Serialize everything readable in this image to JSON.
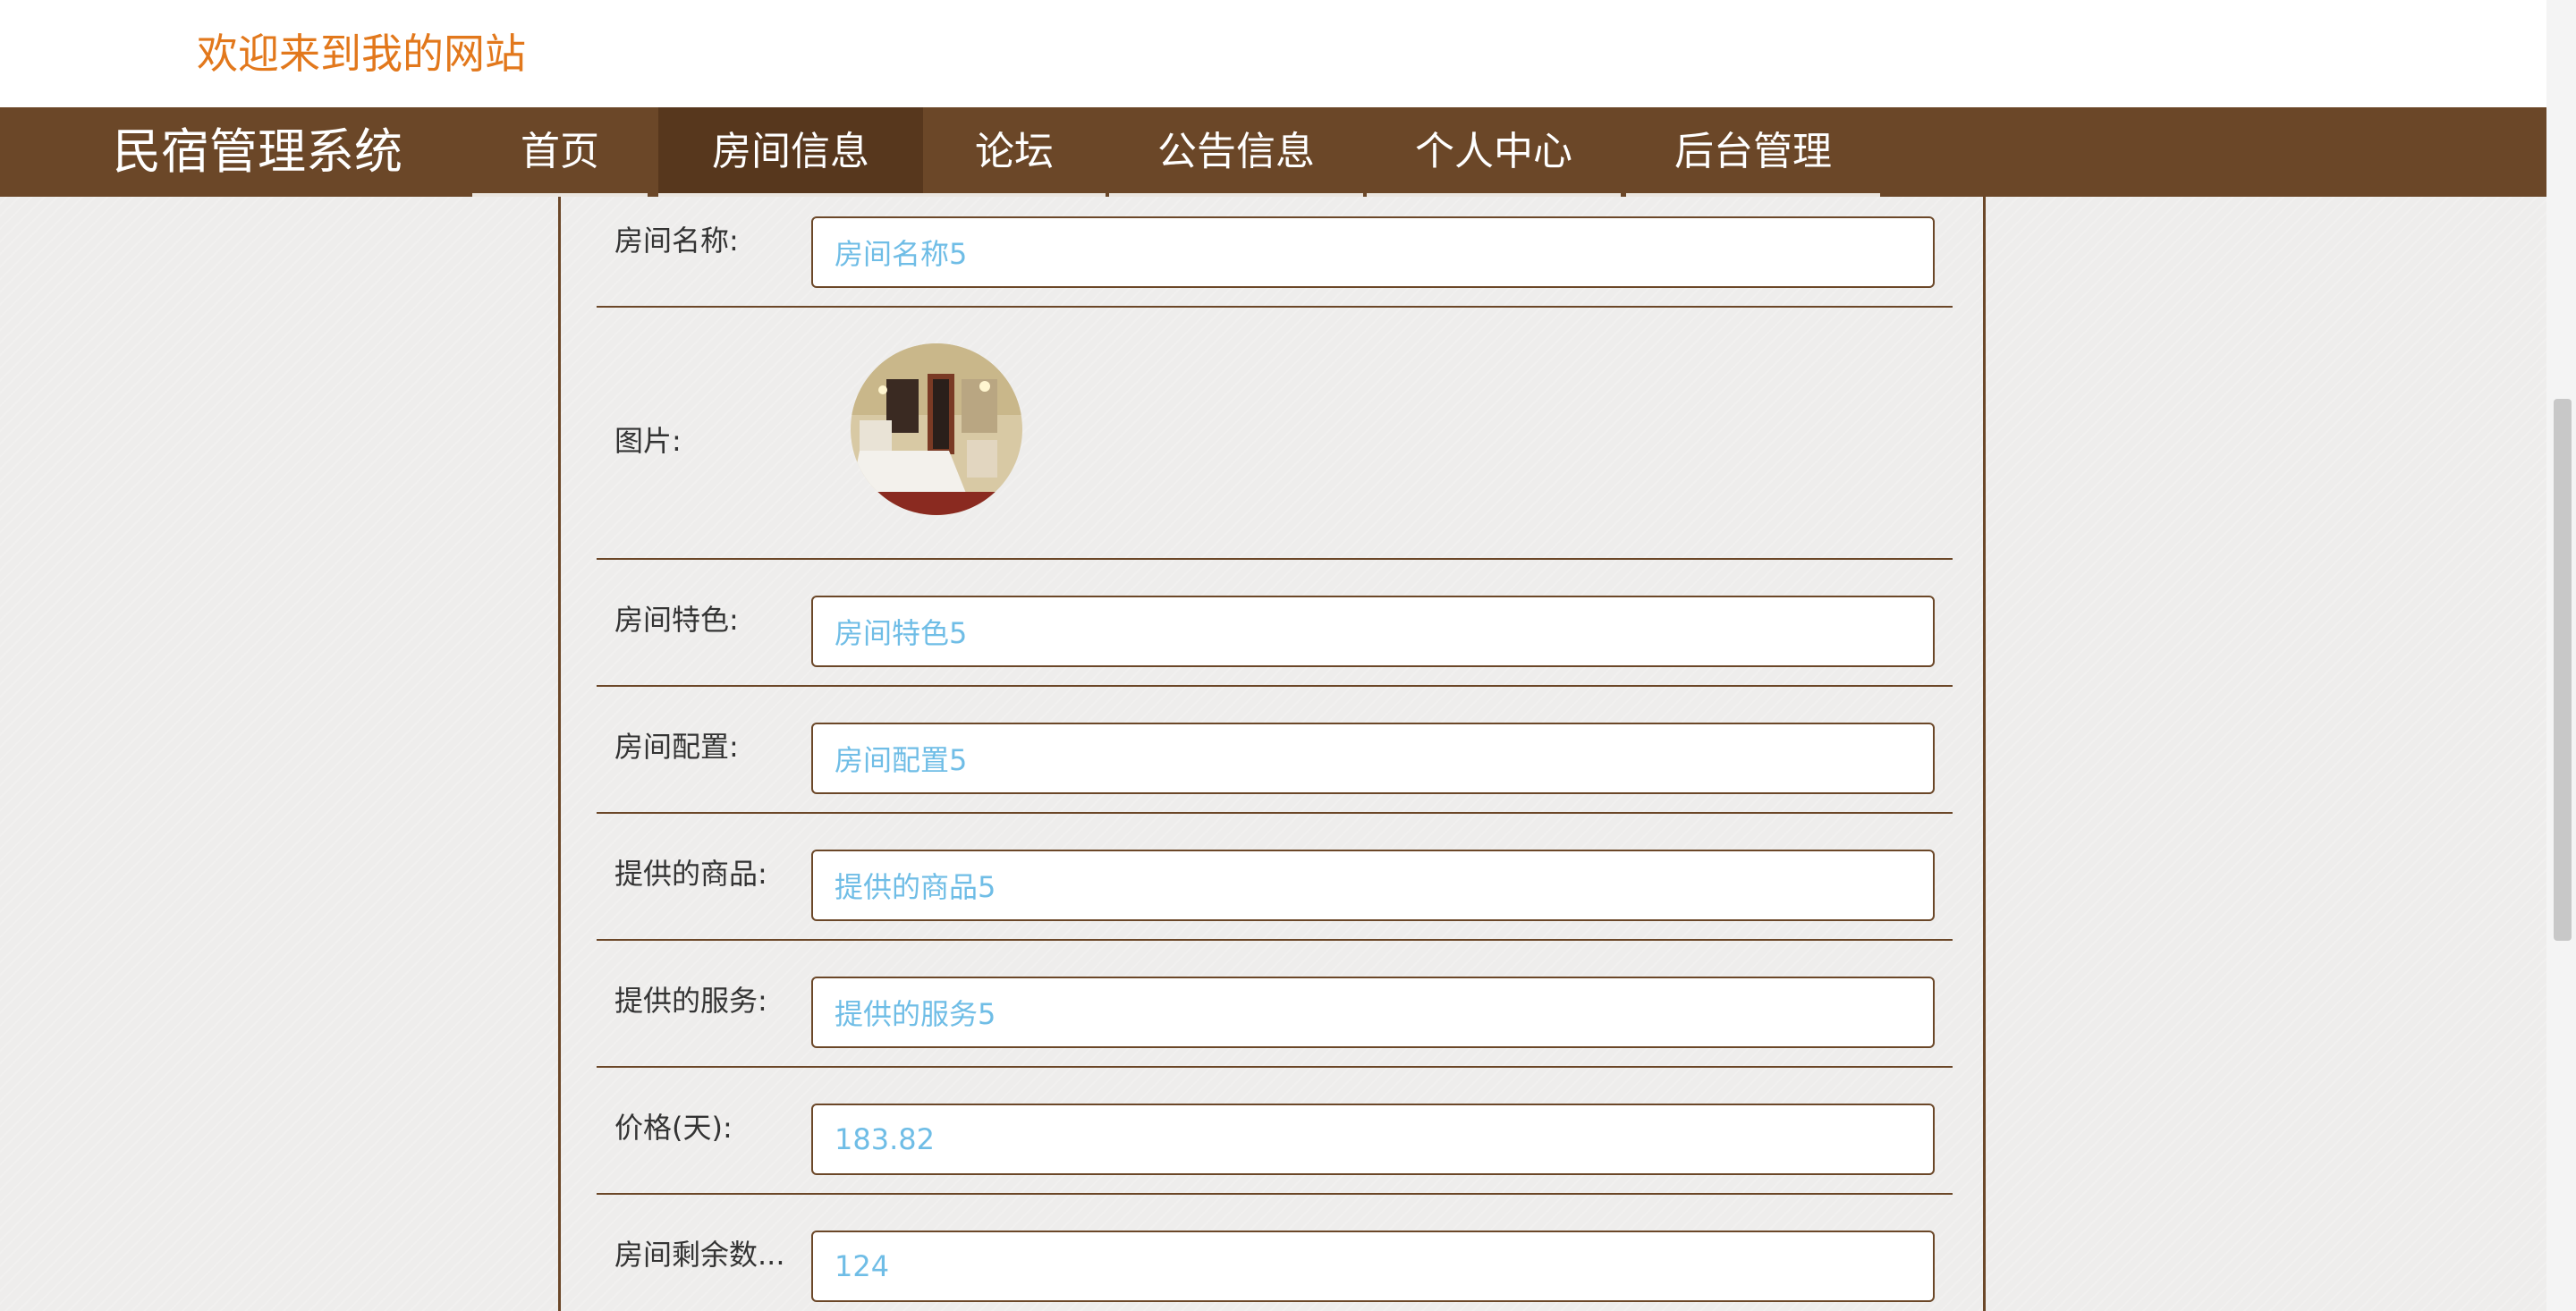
{
  "header": {
    "welcome": "欢迎来到我的网站"
  },
  "nav": {
    "brand": "民宿管理系统",
    "items": [
      {
        "label": "首页",
        "active": false
      },
      {
        "label": "房间信息",
        "active": true
      },
      {
        "label": "论坛",
        "active": false
      },
      {
        "label": "公告信息",
        "active": false
      },
      {
        "label": "个人中心",
        "active": false
      },
      {
        "label": "后台管理",
        "active": false
      }
    ]
  },
  "form": {
    "room_name": {
      "label": "房间名称:",
      "value": "房间名称5"
    },
    "image": {
      "label": "图片:"
    },
    "feature": {
      "label": "房间特色:",
      "value": "房间特色5"
    },
    "config": {
      "label": "房间配置:",
      "value": "房间配置5"
    },
    "goods": {
      "label": "提供的商品:",
      "value": "提供的商品5"
    },
    "service": {
      "label": "提供的服务:",
      "value": "提供的服务5"
    },
    "price": {
      "label": "价格(天):",
      "value": "183.82"
    },
    "remaining": {
      "label": "房间剩余数...",
      "value": "124"
    }
  },
  "colors": {
    "brand_brown": "#6b4728",
    "active_brown": "#57371d",
    "welcome_orange": "#e2781c",
    "value_blue": "#6fbde6"
  },
  "icons": {
    "room_image": "hotel-room-photo"
  }
}
